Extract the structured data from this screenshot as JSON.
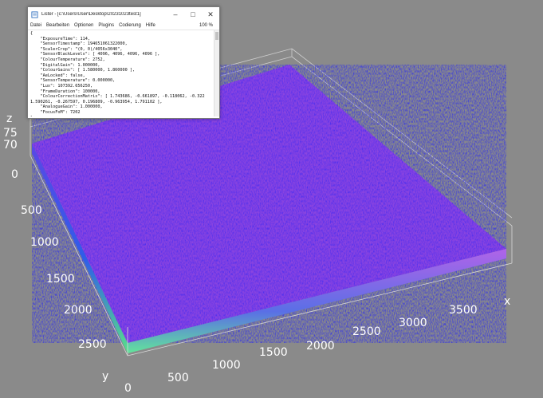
{
  "lister": {
    "title": "Lister - [c:\\Users\\User\\Desktop\\20231023test1]",
    "menu": [
      "Datei",
      "Bearbeiten",
      "Optionen",
      "Plugins",
      "Codierung",
      "Hilfe"
    ],
    "zoom": "100 %",
    "icons": [
      "app-icon",
      "minimize-icon",
      "maximize-icon",
      "close-icon"
    ],
    "lines": [
      "{",
      "    \"ExposureTime\": 114,",
      "    \"SensorTimestamp\": 194651061322000,",
      "    \"ScalerCrop\": \"(0, 0)/4056x3040\",",
      "    \"SensorBlackLevels\": [ 4096, 4096, 4096, 4096 ],",
      "    \"ColourTemperature\": 2752,",
      "    \"DigitalGain\": 1.000000,",
      "    \"ColourGains\": [ 1.580000, 1.860000 ],",
      "    \"AeLocked\": false,",
      "    \"SensorTemperature\": 0.000000,",
      "    \"Lux\": 107392.656250,",
      "    \"FrameDuration\": 100000,",
      "    \"ColourCorrectionMatrix\": [ 1.743686, -0.661897, -0.118062, -0.322",
      "1.590261, -0.267597, 0.196809, -0.963954, 1.791102 ],",
      "    \"AnalogueGain\": 1.000000,",
      "    \"FocusFoM\": 7202",
      "}"
    ]
  },
  "plot": {
    "z_axis": {
      "name": "z",
      "ticks": [
        "75",
        "70",
        "0"
      ]
    },
    "y_axis": {
      "name": "y",
      "ticks": [
        "0",
        "500",
        "1000",
        "1500",
        "2000",
        "2500"
      ]
    },
    "x_axis": {
      "name": "x",
      "ticks": [
        "0",
        "500",
        "1000",
        "1500",
        "2000",
        "2500",
        "3000",
        "3500"
      ]
    },
    "colors": {
      "background": "#8a8a8a",
      "surface_blue": "#3a2ff0",
      "surface_magenta": "#c85ae6",
      "edge_green": "#4fe07a",
      "box_lines": "#cfcfcf"
    }
  }
}
